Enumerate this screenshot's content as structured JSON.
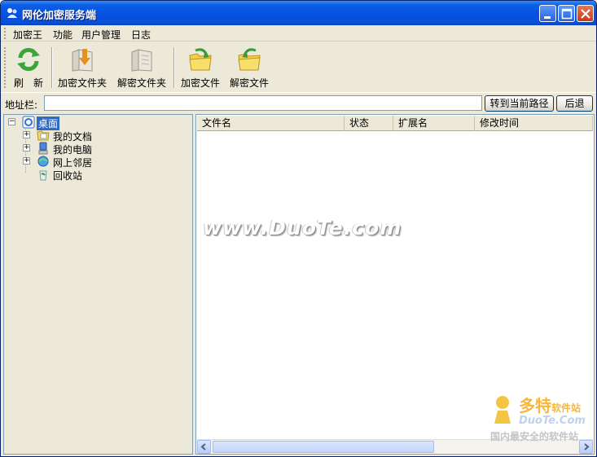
{
  "window": {
    "title": "网伦加密服务端",
    "app_icon": "app-icon",
    "controls": [
      "minimize-icon",
      "maximize-icon",
      "close-icon"
    ]
  },
  "menubar": {
    "items": [
      "加密王",
      "功能",
      "用户管理",
      "日志"
    ]
  },
  "toolbar": {
    "items": [
      {
        "label": "刷　新",
        "icon": "refresh-icon"
      },
      {
        "label": "加密文件夹",
        "icon": "encrypt-folder-icon"
      },
      {
        "label": "解密文件夹",
        "icon": "decrypt-folder-icon"
      },
      {
        "label": "加密文件",
        "icon": "encrypt-file-icon"
      },
      {
        "label": "解密文件",
        "icon": "decrypt-file-icon"
      }
    ]
  },
  "address": {
    "label": "地址栏:",
    "value": "",
    "goto_button": "转到当前路径",
    "back_button": "后退"
  },
  "tree": {
    "root": {
      "label": "桌面",
      "icon": "desktop-icon",
      "expanded": true
    },
    "children": [
      {
        "label": "我的文档",
        "icon": "my-documents-icon",
        "expandable": true
      },
      {
        "label": "我的电脑",
        "icon": "my-computer-icon",
        "expandable": true
      },
      {
        "label": "网上邻居",
        "icon": "network-places-icon",
        "expandable": true
      },
      {
        "label": "回收站",
        "icon": "recycle-bin-icon",
        "expandable": false
      }
    ]
  },
  "list": {
    "columns": [
      "文件名",
      "状态",
      "扩展名",
      "修改时间"
    ],
    "rows": []
  },
  "watermark": {
    "text": "www.DuoTe.com"
  },
  "badge": {
    "name_main": "多特",
    "name_small": "软件站",
    "url": "DuoTe.Com",
    "slogan": "国内最安全的软件站"
  },
  "colors": {
    "titlebar": "#0650e0",
    "chrome": "#ece9d8",
    "selection": "#316ac5",
    "border": "#7f9db9"
  }
}
